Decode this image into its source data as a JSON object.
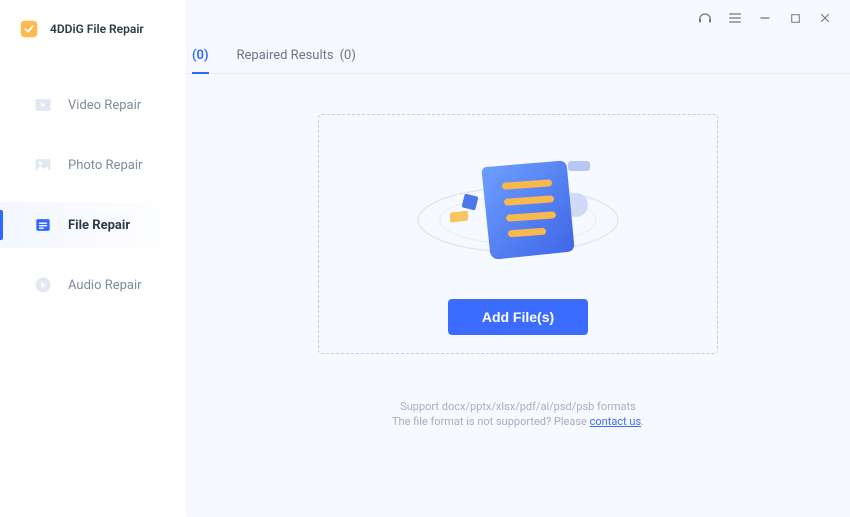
{
  "app": {
    "name": "4DDiG File Repair"
  },
  "sidebar": {
    "items": [
      {
        "label": "Video Repair"
      },
      {
        "label": "Photo Repair"
      },
      {
        "label": "File Repair"
      },
      {
        "label": "Audio Repair"
      }
    ]
  },
  "tabs": {
    "unrepaired_count": "(0)",
    "repaired_label": "Repaired Results",
    "repaired_count": "(0)"
  },
  "main": {
    "add_button": "Add File(s)",
    "support_line1": "Support docx/pptx/xlsx/pdf/ai/psd/psb formats",
    "support_line2_prefix": "The file format is not supported? Please ",
    "support_link": "contact us",
    "support_line2_suffix": "."
  }
}
